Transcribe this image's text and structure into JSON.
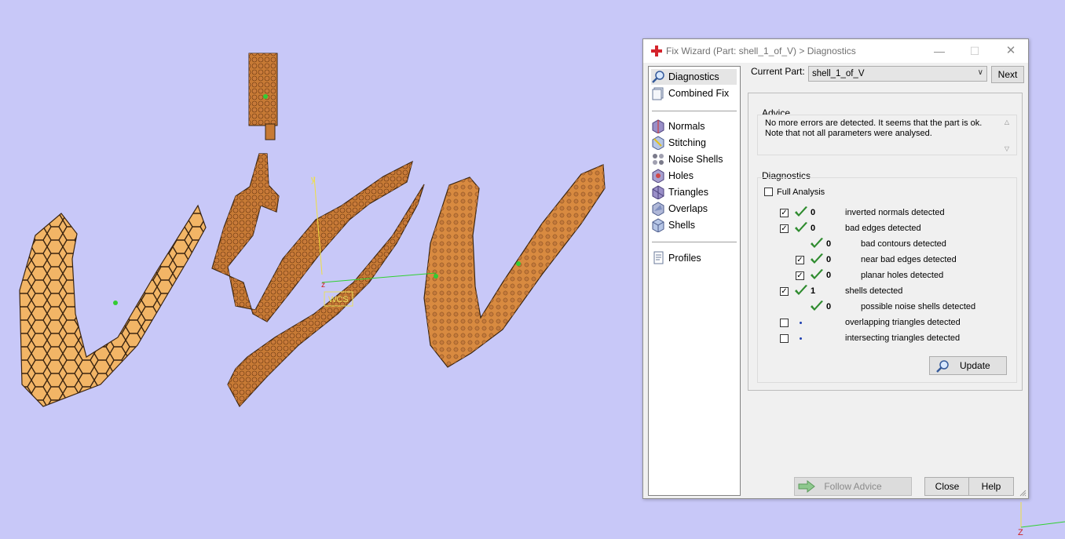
{
  "viewport": {
    "axis_y_label": "y",
    "axis_z_label": "z",
    "wcs_label": "WCS",
    "corner_axis_label": "Z",
    "colors": {
      "background": "#c8c8f8",
      "part_fill": "#f0b05a",
      "part_dark": "#c06a2a"
    }
  },
  "dialog": {
    "title": "Fix Wizard (Part: shell_1_of_V) > Diagnostics",
    "title_icon": "red-cross-icon",
    "window_controls": {
      "minimize": "—",
      "maximize": "☐",
      "close": "✕"
    },
    "nav": {
      "top": [
        {
          "label": "Diagnostics",
          "icon": "magnifier-icon",
          "selected": true
        },
        {
          "label": "Combined Fix",
          "icon": "combined-fix-icon"
        }
      ],
      "tools": [
        {
          "label": "Normals",
          "icon": "normals-icon"
        },
        {
          "label": "Stitching",
          "icon": "stitching-icon"
        },
        {
          "label": "Noise Shells",
          "icon": "noise-shells-icon"
        },
        {
          "label": "Holes",
          "icon": "holes-icon"
        },
        {
          "label": "Triangles",
          "icon": "triangles-icon"
        },
        {
          "label": "Overlaps",
          "icon": "overlaps-icon"
        },
        {
          "label": "Shells",
          "icon": "shells-icon"
        }
      ],
      "bottom": [
        {
          "label": "Profiles",
          "icon": "profiles-icon"
        }
      ]
    },
    "current_part_label": "Current Part:",
    "current_part_value": "shell_1_of_V",
    "next_label": "Next",
    "advice": {
      "title": "Advice",
      "text": "No more errors are detected. It seems that the part is ok. Note that not all parameters were analysed."
    },
    "diagnostics": {
      "title": "Diagnostics",
      "full_analysis_label": "Full Analysis",
      "full_analysis_checked": false,
      "rows": [
        {
          "checkbox": true,
          "checked": true,
          "status": "ok",
          "count": "0",
          "text": "inverted normals detected",
          "indent": 0
        },
        {
          "checkbox": true,
          "checked": true,
          "status": "ok",
          "count": "0",
          "text": "bad edges detected",
          "indent": 0
        },
        {
          "checkbox": false,
          "checked": false,
          "status": "ok",
          "count": "0",
          "text": "bad contours detected",
          "indent": 1
        },
        {
          "checkbox": true,
          "checked": true,
          "status": "ok",
          "count": "0",
          "text": "near bad edges detected",
          "indent": 1
        },
        {
          "checkbox": true,
          "checked": true,
          "status": "ok",
          "count": "0",
          "text": "planar holes detected",
          "indent": 1
        },
        {
          "checkbox": true,
          "checked": true,
          "status": "ok",
          "count": "1",
          "text": "shells detected",
          "indent": 0
        },
        {
          "checkbox": false,
          "checked": false,
          "status": "ok",
          "count": "0",
          "text": "possible noise shells detected",
          "indent": 1
        },
        {
          "checkbox": true,
          "checked": false,
          "status": "dot",
          "count": "",
          "text": "overlapping triangles detected",
          "indent": 0
        },
        {
          "checkbox": true,
          "checked": false,
          "status": "dot",
          "count": "",
          "text": "intersecting triangles detected",
          "indent": 0
        }
      ],
      "check_color": "#2e8b2e"
    },
    "update_label": "Update",
    "follow_advice_label": "Follow Advice",
    "close_label": "Close",
    "help_label": "Help"
  }
}
